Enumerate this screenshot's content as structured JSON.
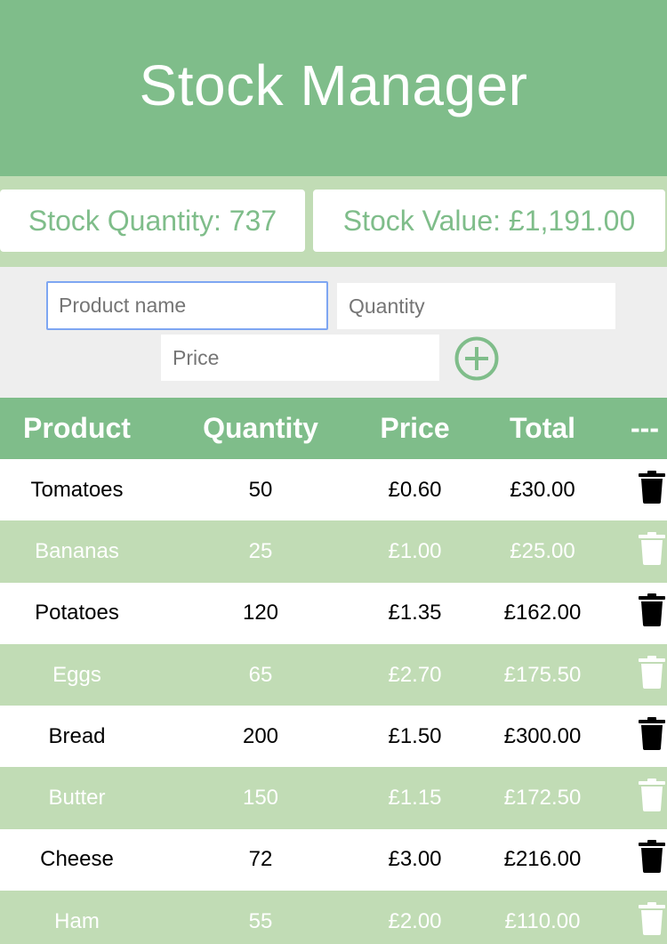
{
  "header": {
    "title": "Stock Manager"
  },
  "stats": {
    "quantity_text": "Stock Quantity: 737",
    "value_text": "Stock Value: £1,191.00"
  },
  "form": {
    "name_placeholder": "Product name",
    "quantity_placeholder": "Quantity",
    "price_placeholder": "Price",
    "add_icon": "plus-circle-icon"
  },
  "table": {
    "headers": [
      "Product",
      "Quantity",
      "Price",
      "Total",
      "---"
    ],
    "delete_icon": "trash-icon",
    "rows": [
      {
        "product": "Tomatoes",
        "quantity": "50",
        "price": "£0.60",
        "total": "£30.00"
      },
      {
        "product": "Bananas",
        "quantity": "25",
        "price": "£1.00",
        "total": "£25.00"
      },
      {
        "product": "Potatoes",
        "quantity": "120",
        "price": "£1.35",
        "total": "£162.00"
      },
      {
        "product": "Eggs",
        "quantity": "65",
        "price": "£2.70",
        "total": "£175.50"
      },
      {
        "product": "Bread",
        "quantity": "200",
        "price": "£1.50",
        "total": "£300.00"
      },
      {
        "product": "Butter",
        "quantity": "150",
        "price": "£1.15",
        "total": "£172.50"
      },
      {
        "product": "Cheese",
        "quantity": "72",
        "price": "£3.00",
        "total": "£216.00"
      },
      {
        "product": "Ham",
        "quantity": "55",
        "price": "£2.00",
        "total": "£110.00"
      }
    ]
  },
  "colors": {
    "primary_green": "#7fbd8a",
    "light_green": "#c1dcb5",
    "form_background": "#eeeeee",
    "focus_border": "#7ea6f2"
  }
}
